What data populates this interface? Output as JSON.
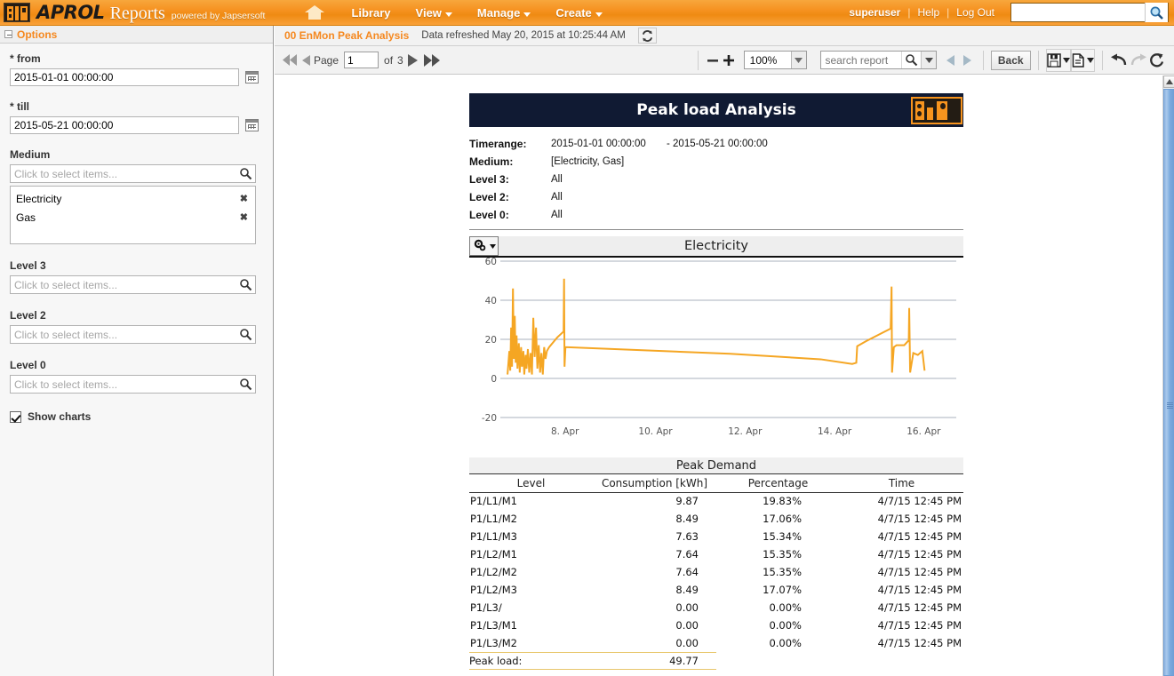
{
  "topbar": {
    "brand_aprol": "APROL",
    "brand_reports": "Reports",
    "powered": "powered by Japsersoft",
    "logo_icon": "br-logo-icon",
    "nav": [
      {
        "label": "Library",
        "caret": false
      },
      {
        "label": "View",
        "caret": true
      },
      {
        "label": "Manage",
        "caret": true
      },
      {
        "label": "Create",
        "caret": true
      }
    ],
    "user": "superuser",
    "help": "Help",
    "logout": "Log Out",
    "sep": "|",
    "search_value": "",
    "search_placeholder": "",
    "accent_color": "#f5881f"
  },
  "options": {
    "panel_title": "Options",
    "from_label": "* from",
    "from_value": "2015-01-01 00:00:00",
    "till_label": "* till",
    "till_value": "2015-05-21 00:00:00",
    "medium_label": "Medium",
    "medium_placeholder": "Click to select items...",
    "medium_selected": [
      "Electricity",
      "Gas"
    ],
    "remove_glyph": "✖",
    "level3_label": "Level 3",
    "level3_placeholder": "Click to select items...",
    "level2_label": "Level 2",
    "level2_placeholder": "Click to select items...",
    "level0_label": "Level 0",
    "level0_placeholder": "Click to select items...",
    "show_charts_label": "Show charts",
    "show_charts_checked": true
  },
  "reportbar": {
    "report_name": "00 EnMon Peak Analysis",
    "refresh_info": "Data refreshed May 20, 2015 at 10:25:44 AM",
    "refresh_icon": "refresh-icon"
  },
  "toolbar": {
    "first_icon": "first-page-icon",
    "prev_icon": "previous-page-icon",
    "page_label": "Page",
    "page_value": "1",
    "of_label": "of",
    "page_total": "3",
    "next_icon": "next-page-icon",
    "last_icon": "last-page-icon",
    "zoom_out_icon": "zoom-out-icon",
    "zoom_in_icon": "zoom-in-icon",
    "zoom_value": "100%",
    "search_placeholder": "search report",
    "search_value": "",
    "search_icon": "magnifier-icon",
    "search_prev_icon": "search-previous-icon",
    "search_next_icon": "search-next-icon",
    "back_label": "Back",
    "save_icon": "save-icon",
    "export_icon": "export-icon",
    "undo_icon": "undo-icon",
    "redo_icon": "redo-icon",
    "revert_icon": "revert-icon"
  },
  "report": {
    "title": "Peak load Analysis",
    "logo_icon": "br-logo-icon",
    "meta": [
      {
        "key": "Timerange:",
        "value": "2015-01-01 00:00:00",
        "value2": "- 2015-05-21 00:00:00"
      },
      {
        "key": "Medium:",
        "value": "[Electricity, Gas]",
        "value2": ""
      },
      {
        "key": "Level 3:",
        "value": "All",
        "value2": ""
      },
      {
        "key": "Level 2:",
        "value": "All",
        "value2": ""
      },
      {
        "key": "Level 0:",
        "value": "All",
        "value2": ""
      }
    ],
    "chart_options_icon": "gear-icon",
    "table": {
      "title": "Peak Demand",
      "columns": [
        "Level",
        "Consumption [kWh]",
        "Percentage",
        "Time"
      ],
      "rows": [
        [
          "P1/L1/M1",
          "9.87",
          "19.83%",
          "4/7/15 12:45 PM"
        ],
        [
          "P1/L1/M2",
          "8.49",
          "17.06%",
          "4/7/15 12:45 PM"
        ],
        [
          "P1/L1/M3",
          "7.63",
          "15.34%",
          "4/7/15 12:45 PM"
        ],
        [
          "P1/L2/M1",
          "7.64",
          "15.35%",
          "4/7/15 12:45 PM"
        ],
        [
          "P1/L2/M2",
          "7.64",
          "15.35%",
          "4/7/15 12:45 PM"
        ],
        [
          "P1/L2/M3",
          "8.49",
          "17.07%",
          "4/7/15 12:45 PM"
        ],
        [
          "P1/L3/",
          "0.00",
          "0.00%",
          "4/7/15 12:45 PM"
        ],
        [
          "P1/L3/M1",
          "0.00",
          "0.00%",
          "4/7/15 12:45 PM"
        ],
        [
          "P1/L3/M2",
          "0.00",
          "0.00%",
          "4/7/15 12:45 PM"
        ]
      ],
      "footer_label": "Peak load:",
      "footer_value": "49.77"
    }
  },
  "chart_data": {
    "type": "line",
    "title": "Electricity",
    "xlabel": "",
    "ylabel": "",
    "ylim": [
      -20,
      60
    ],
    "yticks": [
      -20,
      0,
      20,
      40,
      60
    ],
    "xticks": [
      "8. Apr",
      "10. Apr",
      "12. Apr",
      "14. Apr",
      "16. Apr"
    ],
    "xtick_positions": [
      0.135,
      0.335,
      0.533,
      0.731,
      0.928
    ],
    "grid": true,
    "legend": "none",
    "series_color": "#f5a623",
    "series": [
      {
        "name": "Electricity",
        "points": [
          [
            0.008,
            2
          ],
          [
            0.012,
            14
          ],
          [
            0.014,
            4
          ],
          [
            0.016,
            26
          ],
          [
            0.018,
            6
          ],
          [
            0.02,
            46
          ],
          [
            0.022,
            10
          ],
          [
            0.024,
            32
          ],
          [
            0.026,
            8
          ],
          [
            0.028,
            22
          ],
          [
            0.03,
            5
          ],
          [
            0.033,
            18
          ],
          [
            0.035,
            3
          ],
          [
            0.038,
            16
          ],
          [
            0.04,
            6
          ],
          [
            0.043,
            14
          ],
          [
            0.045,
            2
          ],
          [
            0.048,
            12
          ],
          [
            0.05,
            5
          ],
          [
            0.053,
            15
          ],
          [
            0.056,
            3
          ],
          [
            0.059,
            13
          ],
          [
            0.062,
            2
          ],
          [
            0.065,
            31
          ],
          [
            0.068,
            11
          ],
          [
            0.071,
            26
          ],
          [
            0.074,
            5
          ],
          [
            0.077,
            17
          ],
          [
            0.08,
            3
          ],
          [
            0.083,
            13
          ],
          [
            0.086,
            2
          ],
          [
            0.089,
            16
          ],
          [
            0.092,
            10
          ],
          [
            0.095,
            14
          ],
          [
            0.1,
            16
          ],
          [
            0.118,
            21
          ],
          [
            0.132,
            24
          ],
          [
            0.133,
            51
          ],
          [
            0.134,
            6
          ],
          [
            0.136,
            16
          ],
          [
            0.3,
            14.5
          ],
          [
            0.5,
            12.6
          ],
          [
            0.7,
            9.8
          ],
          [
            0.77,
            7.4
          ],
          [
            0.779,
            8
          ],
          [
            0.781,
            16.5
          ],
          [
            0.8,
            19
          ],
          [
            0.855,
            25.5
          ],
          [
            0.857,
            47
          ],
          [
            0.858,
            3
          ],
          [
            0.862,
            16
          ],
          [
            0.868,
            17
          ],
          [
            0.885,
            17
          ],
          [
            0.895,
            19.5
          ],
          [
            0.896,
            36
          ],
          [
            0.898,
            3
          ],
          [
            0.905,
            13
          ],
          [
            0.915,
            12
          ],
          [
            0.925,
            14
          ],
          [
            0.93,
            4
          ]
        ]
      }
    ]
  },
  "scrollbar": {
    "up_icon": "scroll-up-icon",
    "grip_icon": "scroll-grip-icon"
  }
}
